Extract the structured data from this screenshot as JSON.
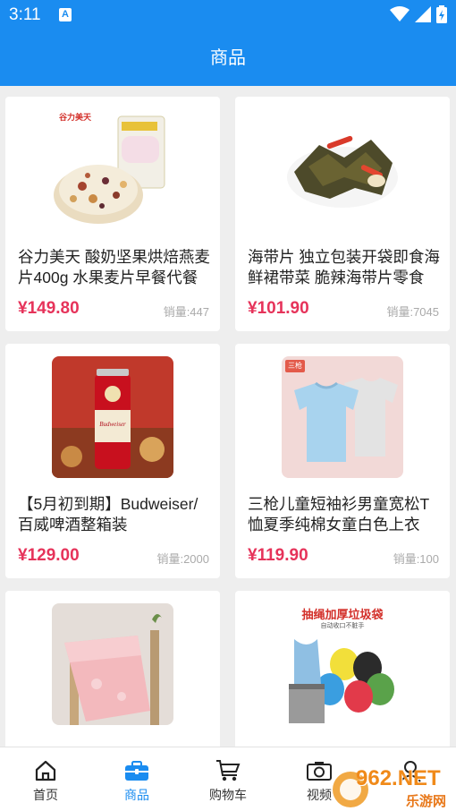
{
  "status_bar": {
    "time": "3:11",
    "notification_badge": "A"
  },
  "header": {
    "title": "商品"
  },
  "products": [
    {
      "title": "谷力美天 酸奶坚果烘焙燕麦片400g 水果麦片早餐代餐",
      "price": "¥149.80",
      "sales": "销量:447",
      "brand_text": "谷力美天"
    },
    {
      "title": "海带片 独立包装开袋即食海鲜裙带菜 脆辣海带片零食",
      "price": "¥101.90",
      "sales": "销量:7045"
    },
    {
      "title": "【5月初到期】Budweiser/百威啤酒整箱装",
      "price": "¥129.00",
      "sales": "销量:2000",
      "can_text": "Budweiser"
    },
    {
      "title": "三枪儿童短袖衫男童宽松T恤夏季纯棉女童白色上衣",
      "price": "¥119.90",
      "sales": "销量:100",
      "tag_text": "三枪"
    },
    {
      "title": "",
      "price": "",
      "sales": ""
    },
    {
      "title": "",
      "price": "",
      "sales": "",
      "banner_text": "抽绳加厚垃圾袋",
      "sub_text": "自动收口不脏手"
    }
  ],
  "tabs": [
    {
      "label": "首页",
      "icon": "home-icon"
    },
    {
      "label": "商品",
      "icon": "briefcase-icon",
      "active": true
    },
    {
      "label": "购物车",
      "icon": "cart-icon"
    },
    {
      "label": "视频",
      "icon": "camera-icon"
    },
    {
      "label": "",
      "icon": "user-icon"
    }
  ],
  "watermark": {
    "text": "962.NET",
    "sub": "乐游网"
  },
  "colors": {
    "primary": "#1a8cf0",
    "price": "#e6335a",
    "background": "#eeeeee"
  }
}
